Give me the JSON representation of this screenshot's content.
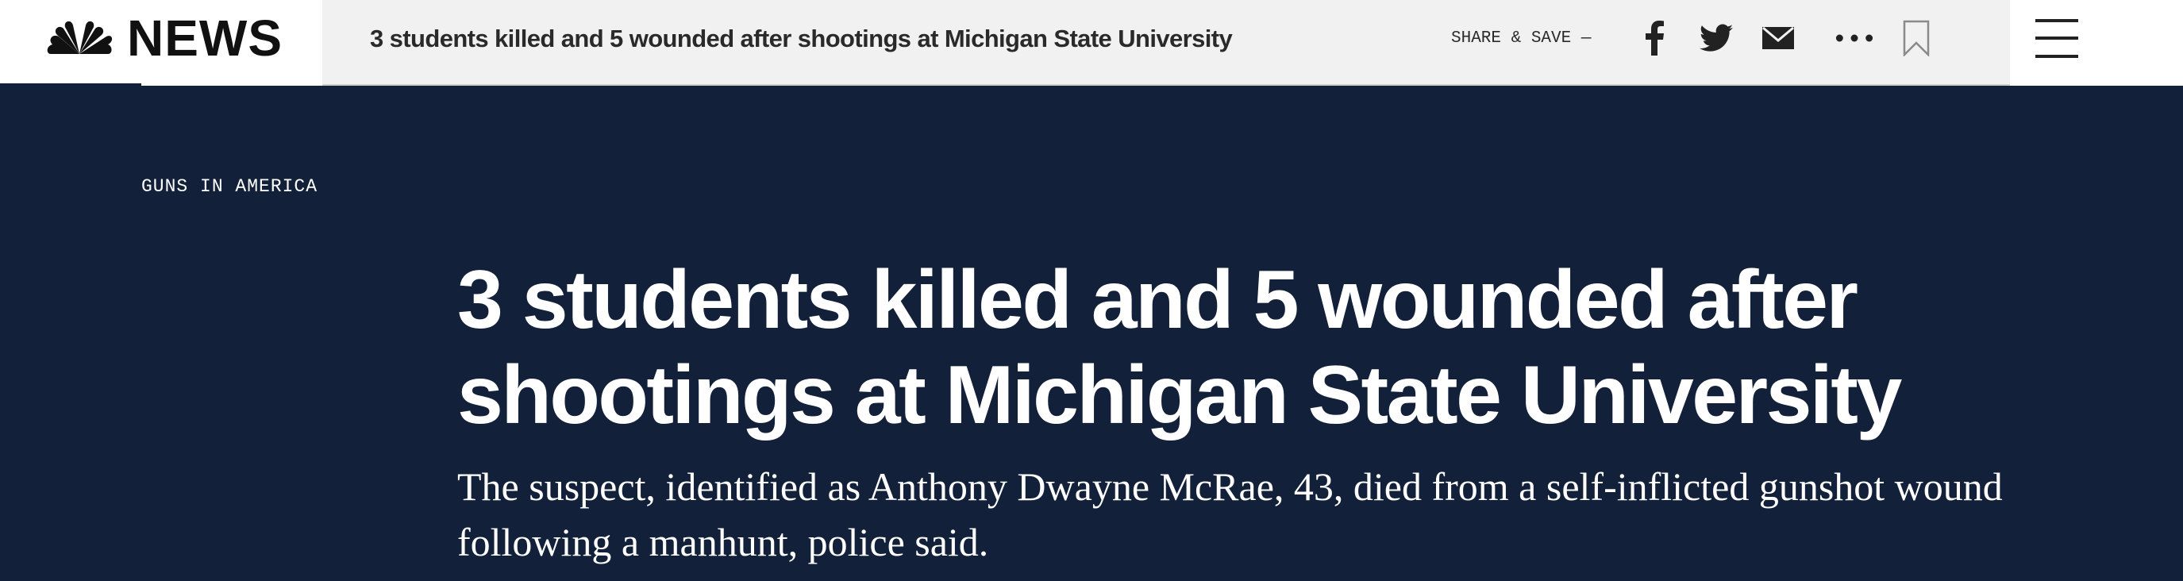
{
  "brand": {
    "logo_text": "NEWS",
    "logo_icon": "nbc-peacock-icon"
  },
  "sticky_bar": {
    "title": "3 students killed and 5 wounded after shootings at Michigan State University",
    "share_label": "SHARE & SAVE —",
    "icons": [
      "facebook-icon",
      "twitter-icon",
      "email-icon",
      "more-icon",
      "bookmark-icon"
    ],
    "menu_icon": "hamburger-menu-icon"
  },
  "article": {
    "eyebrow": "GUNS IN AMERICA",
    "headline": "3 students killed and 5 wounded after shootings at Michigan State University",
    "dek": "The suspect, identified as Anthony Dwayne McRae, 43, died from a self-inflicted gunshot wound following a manhunt, police said."
  },
  "colors": {
    "hero_background": "#12203a",
    "bar_background": "#f1f1f1",
    "text_dark": "#2a2a2a",
    "text_light": "#ffffff"
  }
}
